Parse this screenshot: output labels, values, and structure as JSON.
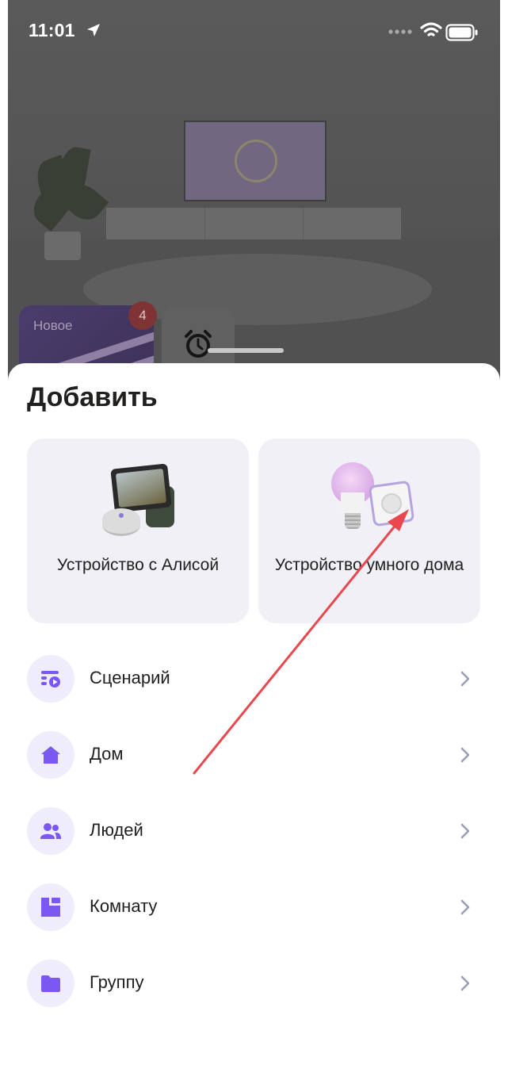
{
  "status_bar": {
    "time": "11:01",
    "icons": [
      "location-arrow-icon",
      "cellular-signal-icon",
      "wifi-icon",
      "battery-icon"
    ]
  },
  "background": {
    "news_label": "Новое",
    "news_badge": "4",
    "alarm_icon": "alarm-clock-icon"
  },
  "sheet": {
    "title": "Добавить",
    "cards": [
      {
        "label": "Устройство с Алисой",
        "icon": "alice-devices-illustration"
      },
      {
        "label": "Устройство умного дома",
        "icon": "smart-home-devices-illustration"
      }
    ],
    "items": [
      {
        "label": "Сценарий",
        "icon": "scenario-icon"
      },
      {
        "label": "Дом",
        "icon": "house-icon"
      },
      {
        "label": "Людей",
        "icon": "people-icon"
      },
      {
        "label": "Комнату",
        "icon": "room-icon"
      },
      {
        "label": "Группу",
        "icon": "folder-icon"
      }
    ]
  },
  "colors": {
    "accent": "#7b58f2",
    "icon_bg": "#efedfb",
    "card_bg": "#f1f0f7",
    "annotation_arrow": "#e8484e"
  }
}
